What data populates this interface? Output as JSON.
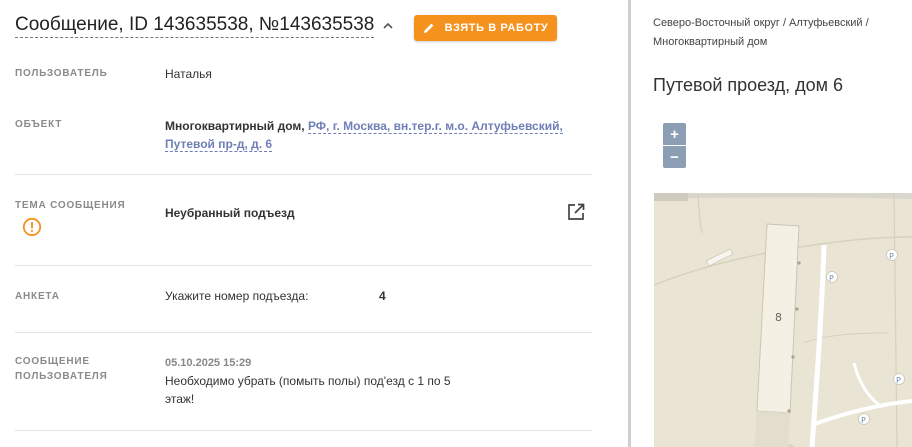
{
  "header": {
    "title": "Сообщение, ID 143635538, №143635538",
    "take_button_label": "ВЗЯТЬ В РАБОТУ"
  },
  "fields": {
    "user": {
      "label": "ПОЛЬЗОВАТЕЛЬ",
      "value": "Наталья"
    },
    "object": {
      "label": "ОБЪЕКТ",
      "type": "Многоквартирный дом,",
      "address_line1": "РФ, г. Москва, вн.тер.г. м.о. Алтуфьевский,",
      "address_line2": "Путевой пр-д, д. 6"
    },
    "topic": {
      "label": "ТЕМА СООБЩЕНИЯ",
      "value": "Неубранный подъезд"
    },
    "survey": {
      "label": "АНКЕТА",
      "question": "Укажите номер подъезда:",
      "answer": "4"
    },
    "message": {
      "label_line1": "СООБЩЕНИЕ",
      "label_line2": "ПОЛЬЗОВАТЕЛЯ",
      "date": "05.10.2025 15:29",
      "text_line1": "Необходимо убрать (помыть полы) под'езд с 1 по 5",
      "text_line2": "этаж!"
    }
  },
  "right_panel": {
    "breadcrumb_line1": "Северо-Восточный округ / Алтуфьевский /",
    "breadcrumb_line2": "Многоквартирный дом",
    "address_title": "Путевой проезд, дом 6",
    "zoom_in": "+",
    "zoom_out": "−",
    "map": {
      "building_number": "8",
      "parking_label": "P"
    }
  },
  "colors": {
    "accent": "#f5921e",
    "link": "#6f7fb6",
    "zoom": "#8c9eb4",
    "warning": "#f5921e"
  }
}
